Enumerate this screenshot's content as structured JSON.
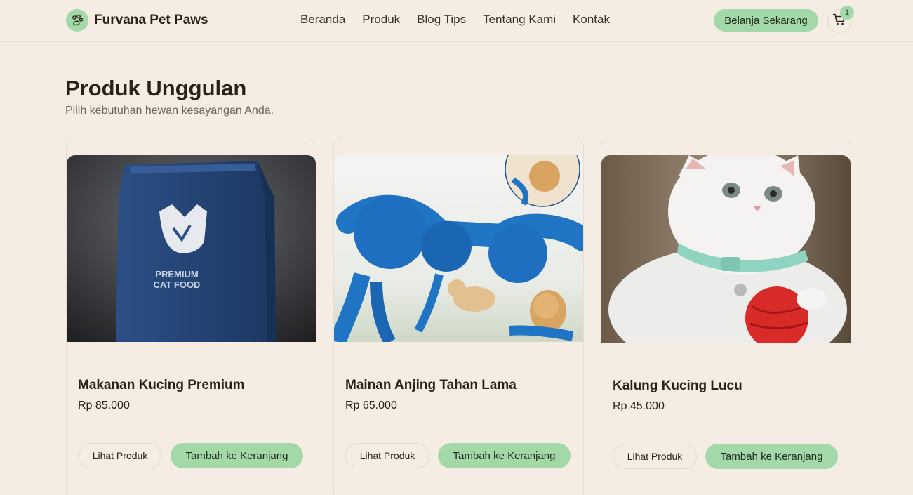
{
  "brand": {
    "name": "Furvana Pet Paws",
    "icon": "paw-icon",
    "accent": "#a3d9a8",
    "background": "#f5ede4"
  },
  "nav": [
    {
      "label": "Beranda"
    },
    {
      "label": "Produk"
    },
    {
      "label": "Blog Tips"
    },
    {
      "label": "Tentang Kami"
    },
    {
      "label": "Kontak"
    }
  ],
  "header": {
    "shop_label": "Belanja Sekarang",
    "cart_icon": "cart-icon",
    "cart_count": "1"
  },
  "section": {
    "title": "Produk Unggulan",
    "subtitle": "Pilih kebutuhan hewan kesayangan Anda."
  },
  "products": [
    {
      "name": "Makanan Kucing Premium",
      "price": "Rp 85.000",
      "view_label": "Lihat Produk",
      "add_label": "Tambah ke Keranjang",
      "image_text": [
        "PREMIUM",
        "CAT FOOD"
      ]
    },
    {
      "name": "Mainan Anjing Tahan Lama",
      "price": "Rp 65.000",
      "view_label": "Lihat Produk",
      "add_label": "Tambah ke Keranjang"
    },
    {
      "name": "Kalung Kucing Lucu",
      "price": "Rp 45.000",
      "view_label": "Lihat Produk",
      "add_label": "Tambah ke Keranjang"
    }
  ]
}
